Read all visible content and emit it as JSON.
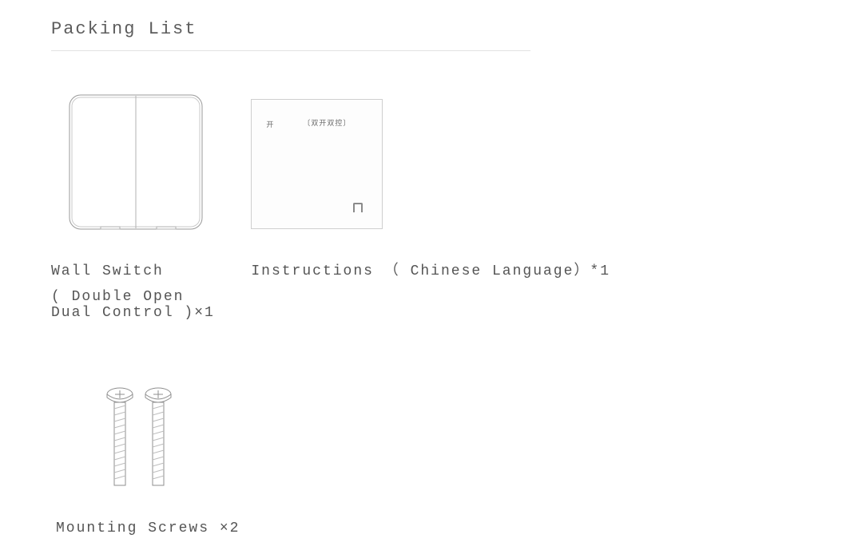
{
  "title": "Packing List",
  "items": {
    "switch": {
      "name_line1": "Wall Switch",
      "name_line2": "( Double Open Dual Control )×1"
    },
    "instructions": {
      "label": "Instructions （ Chinese Language）*1",
      "card_small_mark": "开",
      "card_chinese": "〔双开双控〕"
    },
    "screws": {
      "label": "Mounting Screws ×2"
    }
  }
}
